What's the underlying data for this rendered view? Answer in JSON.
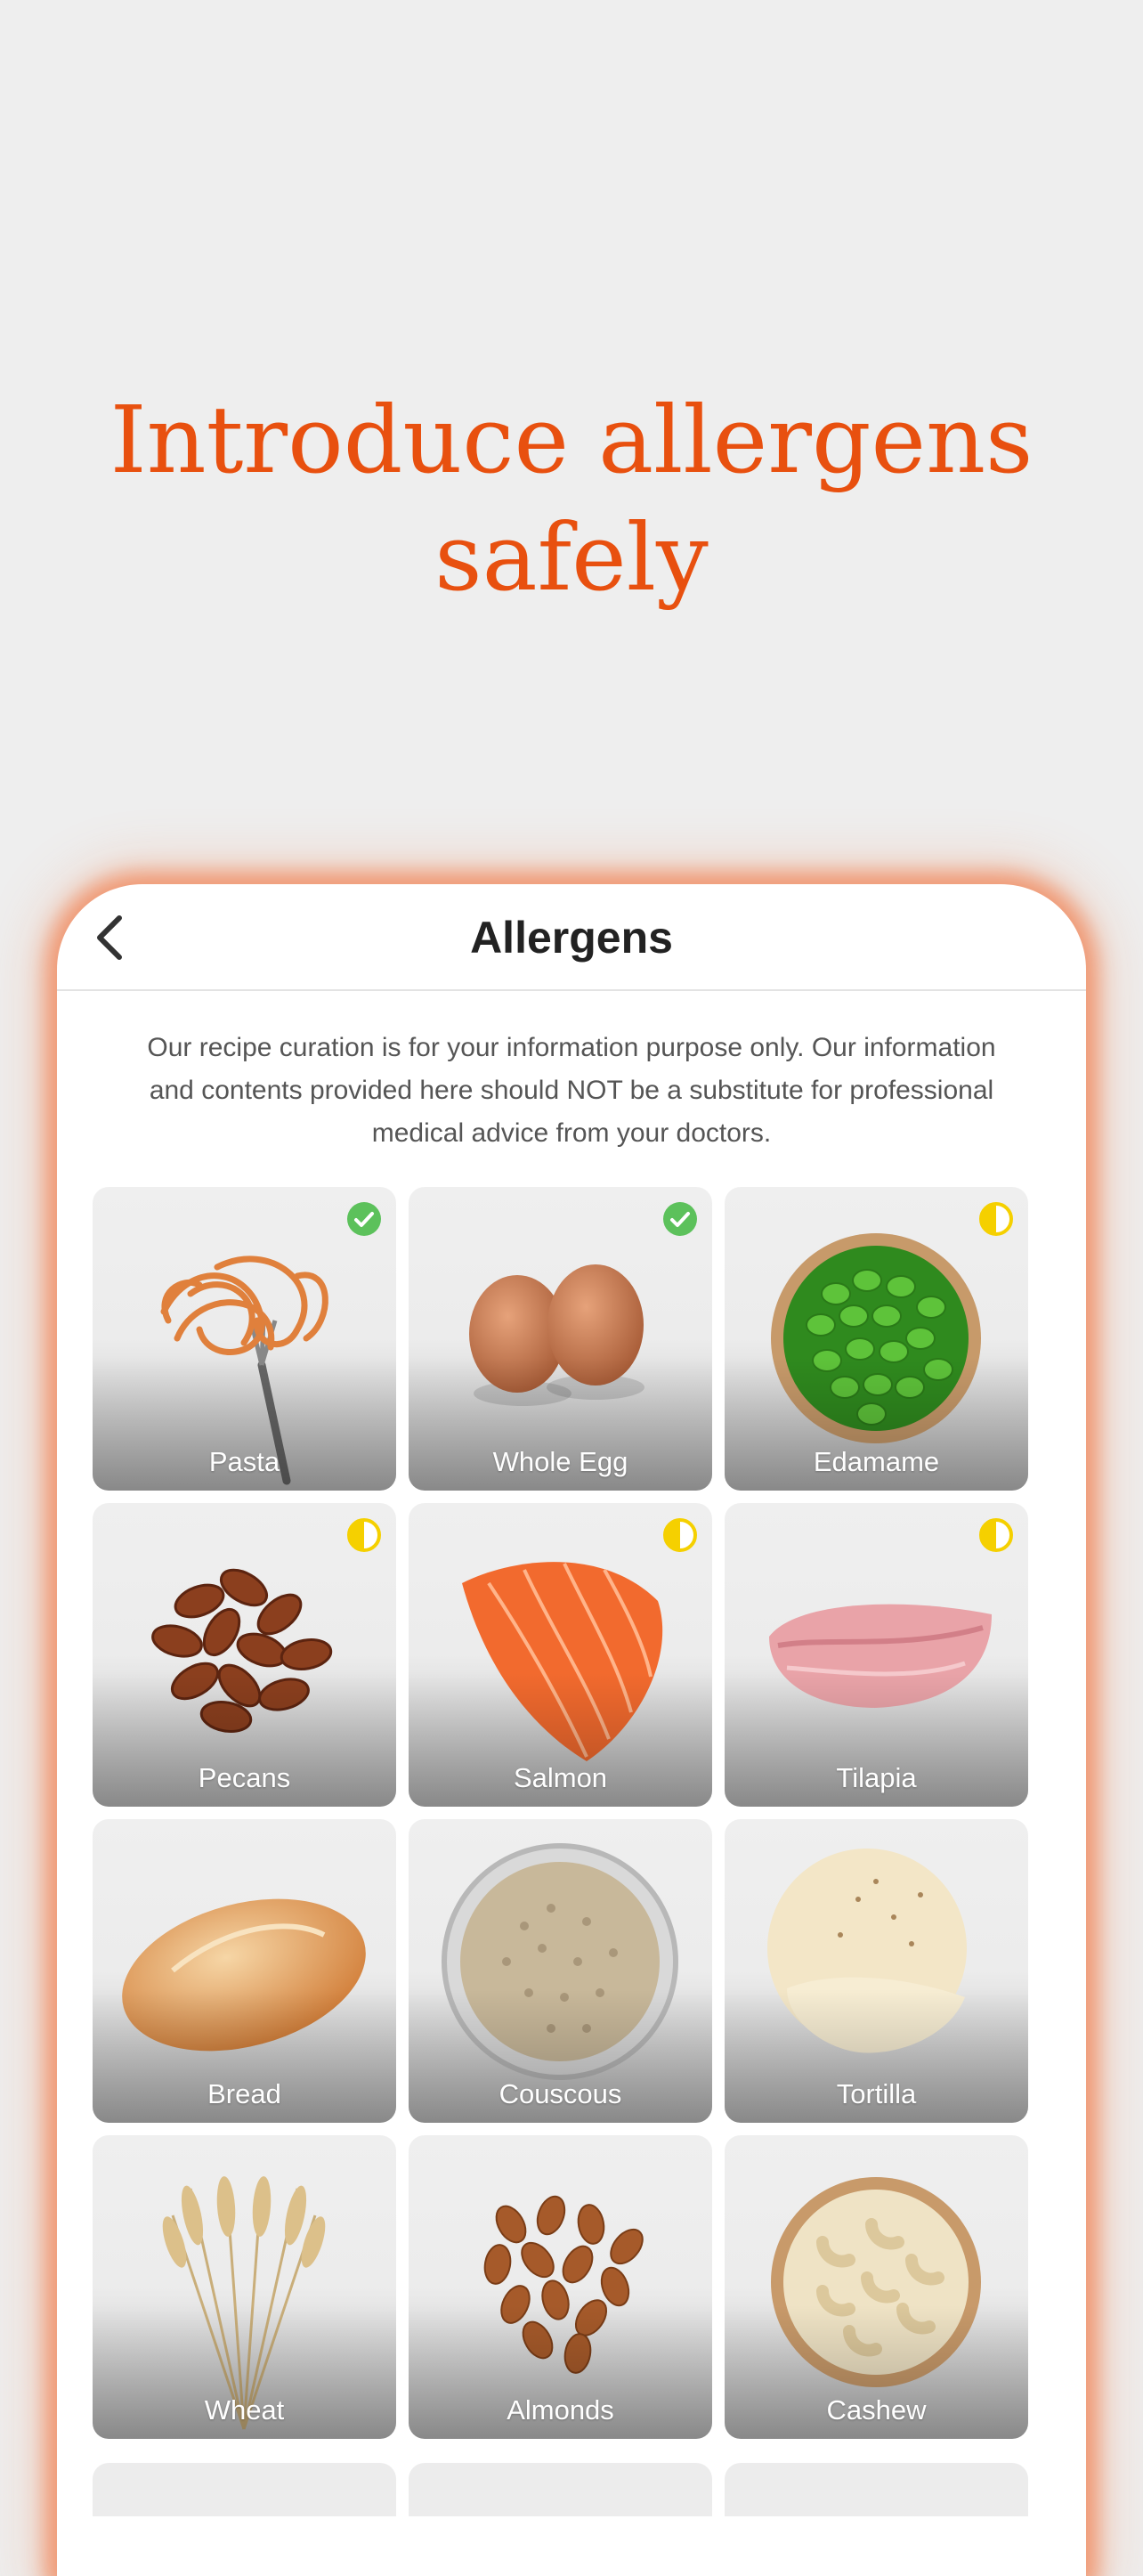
{
  "hero": {
    "line1": "Introduce allergens",
    "line2": "safely"
  },
  "header": {
    "title": "Allergens"
  },
  "disclaimer": "Our recipe curation is for your information purpose only. Our information and contents provided here should NOT be a substitute for professional medical advice from your doctors.",
  "colors": {
    "accent": "#e8500f",
    "check": "#5cc15b",
    "partial": "#f5d000"
  },
  "foods": [
    {
      "label": "Pasta",
      "status": "check",
      "icon": "pasta-fork-icon"
    },
    {
      "label": "Whole Egg",
      "status": "check",
      "icon": "egg-icon"
    },
    {
      "label": "Edamame",
      "status": "half",
      "icon": "edamame-bowl-icon"
    },
    {
      "label": "Pecans",
      "status": "half",
      "icon": "pecans-icon"
    },
    {
      "label": "Salmon",
      "status": "half",
      "icon": "salmon-fillet-icon"
    },
    {
      "label": "Tilapia",
      "status": "half",
      "icon": "tilapia-fillet-icon"
    },
    {
      "label": "Bread",
      "status": "none",
      "icon": "bread-roll-icon"
    },
    {
      "label": "Couscous",
      "status": "none",
      "icon": "couscous-bowl-icon"
    },
    {
      "label": "Tortilla",
      "status": "none",
      "icon": "tortilla-icon"
    },
    {
      "label": "Wheat",
      "status": "none",
      "icon": "wheat-icon"
    },
    {
      "label": "Almonds",
      "status": "none",
      "icon": "almonds-icon"
    },
    {
      "label": "Cashew",
      "status": "none",
      "icon": "cashew-bowl-icon"
    }
  ]
}
